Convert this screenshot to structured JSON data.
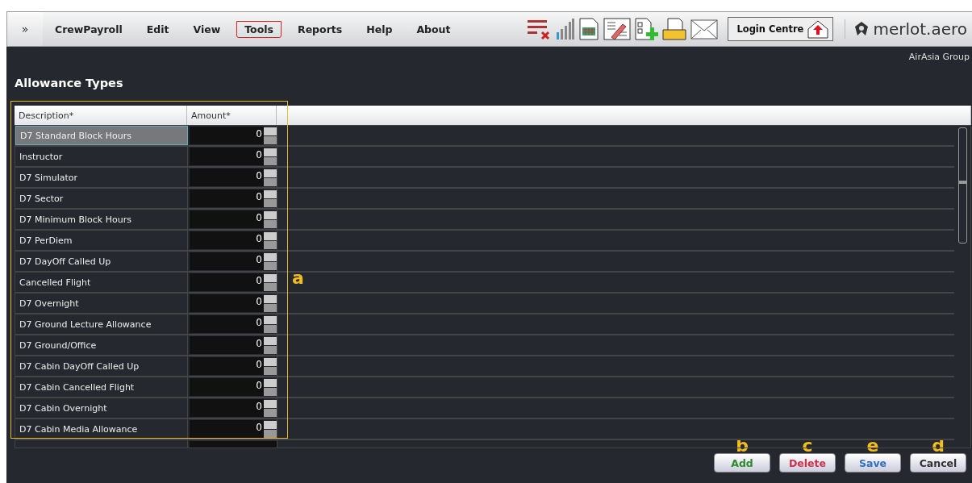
{
  "menu": [
    {
      "label": "CrewPayroll",
      "selected": false
    },
    {
      "label": "Edit",
      "selected": false
    },
    {
      "label": "View",
      "selected": false
    },
    {
      "label": "Tools",
      "selected": true
    },
    {
      "label": "Reports",
      "selected": false
    },
    {
      "label": "Help",
      "selected": false
    },
    {
      "label": "About",
      "selected": false
    }
  ],
  "menu_toggle": "»",
  "login_button": "Login Centre",
  "logo": "merlot.aero",
  "organisation": "AirAsia Group",
  "page_title": "Allowance Types",
  "table": {
    "columns": [
      "Description*",
      "Amount*"
    ],
    "rows": [
      {
        "description": "D7 Standard Block Hours",
        "amount": "0",
        "selected": true
      },
      {
        "description": "Instructor",
        "amount": "0",
        "selected": false
      },
      {
        "description": "D7 Simulator",
        "amount": "0",
        "selected": false
      },
      {
        "description": "D7 Sector",
        "amount": "0",
        "selected": false
      },
      {
        "description": "D7 Minimum Block Hours",
        "amount": "0",
        "selected": false
      },
      {
        "description": "D7 PerDiem",
        "amount": "0",
        "selected": false
      },
      {
        "description": "D7 DayOff Called Up",
        "amount": "0",
        "selected": false
      },
      {
        "description": "Cancelled Flight",
        "amount": "0",
        "selected": false
      },
      {
        "description": "D7 Overnight",
        "amount": "0",
        "selected": false
      },
      {
        "description": "D7 Ground Lecture Allowance",
        "amount": "0",
        "selected": false
      },
      {
        "description": "D7 Ground/Office",
        "amount": "0",
        "selected": false
      },
      {
        "description": "D7 Cabin DayOff Called Up",
        "amount": "0",
        "selected": false
      },
      {
        "description": "D7 Cabin Cancelled Flight",
        "amount": "0",
        "selected": false
      },
      {
        "description": "D7 Cabin Overnight",
        "amount": "0",
        "selected": false
      },
      {
        "description": "D7 Cabin Media Allowance",
        "amount": "0",
        "selected": false
      }
    ]
  },
  "buttons": [
    {
      "label": "Add",
      "kind": "add",
      "annotation": "b"
    },
    {
      "label": "Delete",
      "kind": "delete",
      "annotation": "c"
    },
    {
      "label": "Save",
      "kind": "save",
      "annotation": "e"
    },
    {
      "label": "Cancel",
      "kind": "cancel",
      "annotation": "d"
    }
  ],
  "table_annotation": "a"
}
